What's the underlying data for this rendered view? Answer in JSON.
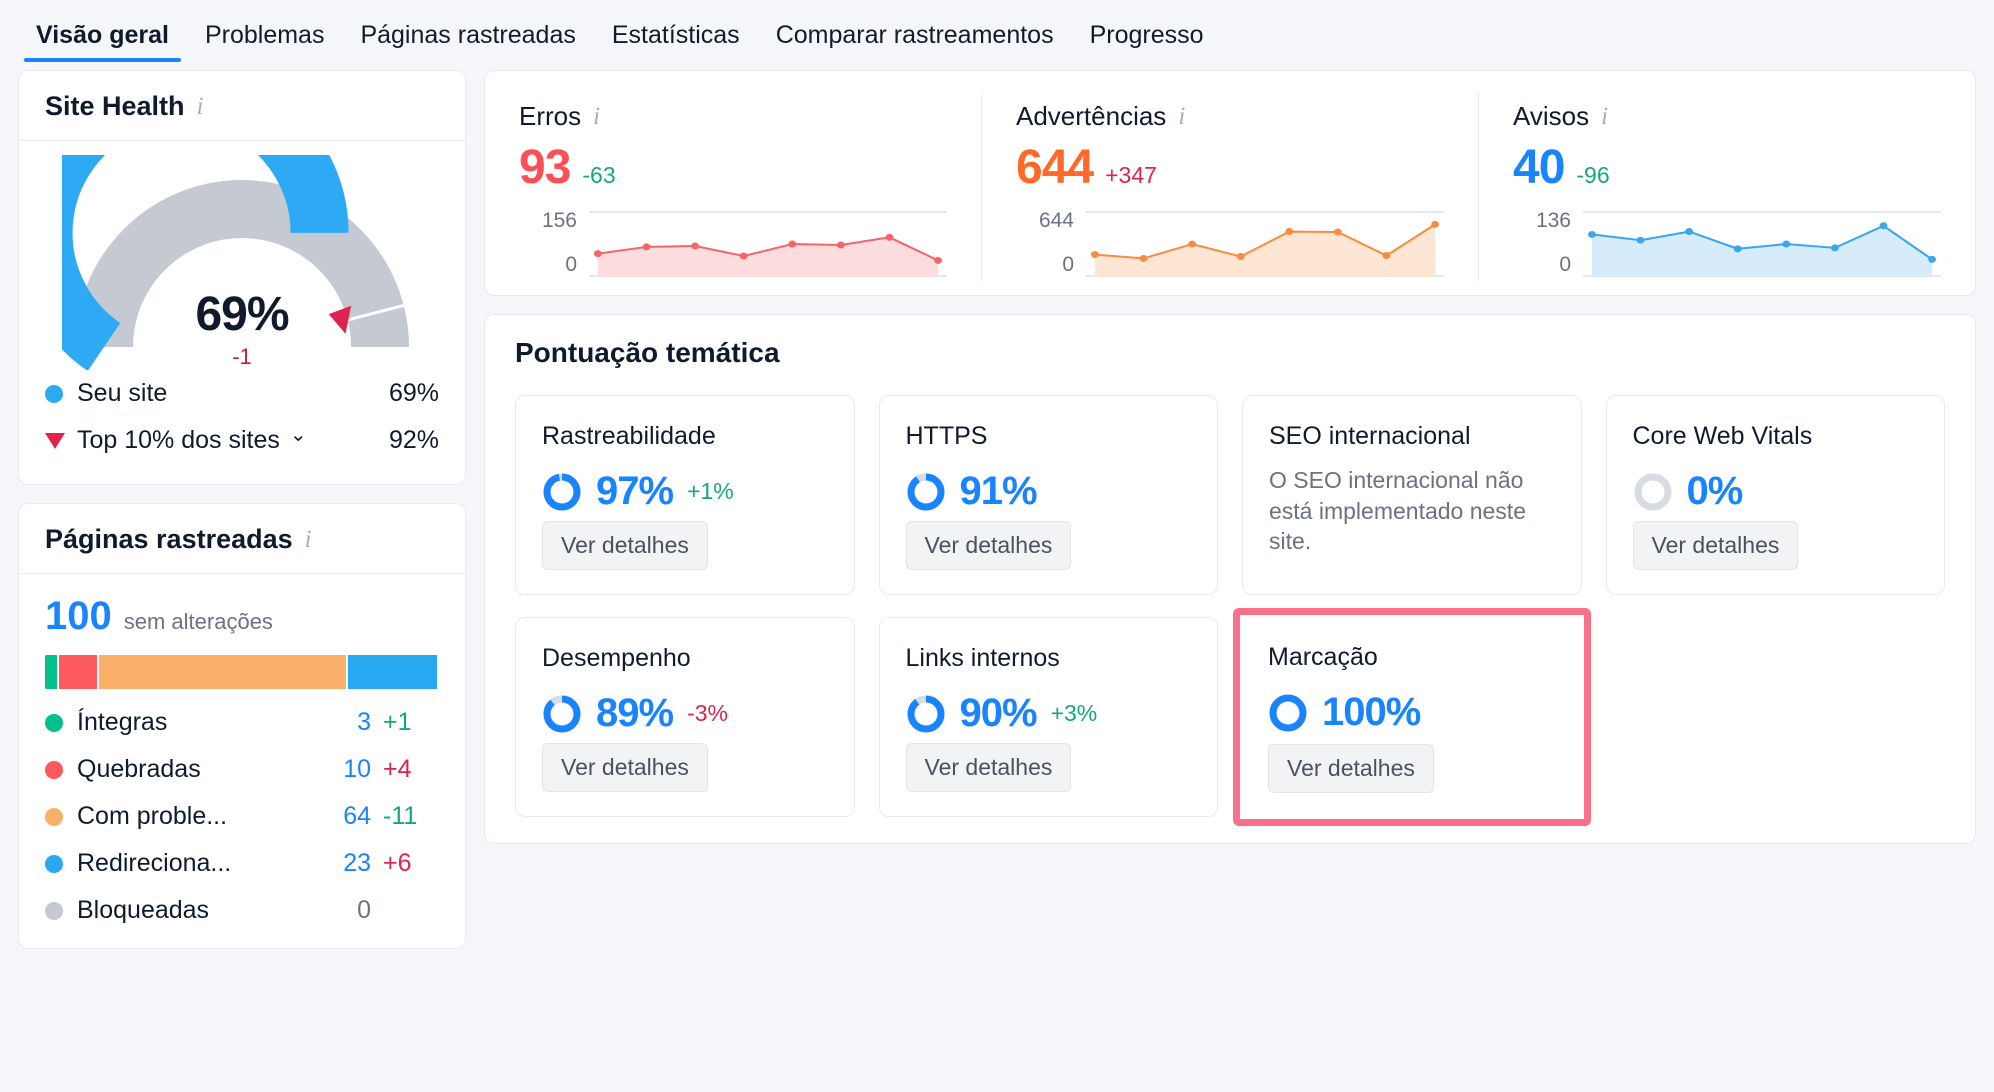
{
  "nav": {
    "tabs": [
      {
        "label": "Visão geral",
        "active": true
      },
      {
        "label": "Problemas",
        "active": false
      },
      {
        "label": "Páginas rastreadas",
        "active": false
      },
      {
        "label": "Estatísticas",
        "active": false
      },
      {
        "label": "Comparar rastreamentos",
        "active": false
      },
      {
        "label": "Progresso",
        "active": false
      }
    ]
  },
  "site_health": {
    "title": "Site Health",
    "info_icon": "info-icon",
    "percent": "69%",
    "delta": "-1",
    "gauge_value": 69,
    "benchmark_value": 92,
    "legend": [
      {
        "marker": "dot",
        "color": "#2eaaf5",
        "label": "Seu site",
        "value": "69%"
      },
      {
        "marker": "triangle",
        "color": "#e0224e",
        "label": "Top 10% dos sites",
        "value": "92%",
        "has_chevron": true
      }
    ]
  },
  "crawled_pages": {
    "title": "Páginas rastreadas",
    "info_icon": "info-icon",
    "total": "100",
    "total_note": "sem alterações",
    "stack": [
      {
        "color": "#00c08b",
        "pct": 3
      },
      {
        "color": "#fc5a5f",
        "pct": 10
      },
      {
        "color": "#fbb069",
        "pct": 64
      },
      {
        "color": "#29a8f2",
        "pct": 23
      }
    ],
    "rows": [
      {
        "color": "#00c08b",
        "label": "Íntegras",
        "value": "3",
        "delta": "+1",
        "delta_dir": "down"
      },
      {
        "color": "#fc5a5f",
        "label": "Quebradas",
        "value": "10",
        "delta": "+4",
        "delta_dir": "up"
      },
      {
        "color": "#fbb069",
        "label": "Com proble...",
        "value": "64",
        "delta": "-11",
        "delta_dir": "down"
      },
      {
        "color": "#29a8f2",
        "label": "Redireciona...",
        "value": "23",
        "delta": "+6",
        "delta_dir": "up"
      },
      {
        "color": "#c4c9d2",
        "label": "Bloqueadas",
        "value": "0",
        "delta": "",
        "delta_dir": "none",
        "value_grey": true
      }
    ]
  },
  "stats": [
    {
      "name": "Erros",
      "info_icon": "info-icon",
      "value": "93",
      "value_color": "#fc4f56",
      "delta": "-63",
      "delta_dir": "down",
      "axis_max": "156",
      "axis_min": "0",
      "line_color": "#f4656b",
      "fill_color": "#fcdcdd",
      "points": [
        0.32,
        0.46,
        0.48,
        0.27,
        0.52,
        0.5,
        0.66,
        0.18
      ]
    },
    {
      "name": "Advertências",
      "info_icon": "info-icon",
      "value": "644",
      "value_color": "#ff6a2b",
      "delta": "+347",
      "delta_dir": "up",
      "axis_max": "644",
      "axis_min": "0",
      "line_color": "#fb8b3e",
      "fill_color": "#fde7d4",
      "points": [
        0.3,
        0.22,
        0.52,
        0.26,
        0.78,
        0.77,
        0.28,
        0.93
      ]
    },
    {
      "name": "Avisos",
      "info_icon": "info-icon",
      "value": "40",
      "value_color": "#1a84ff",
      "delta": "-96",
      "delta_dir": "down",
      "axis_max": "136",
      "axis_min": "0",
      "line_color": "#3aa6f0",
      "fill_color": "#d6ecfb",
      "points": [
        0.72,
        0.6,
        0.78,
        0.42,
        0.52,
        0.44,
        0.9,
        0.2
      ]
    }
  ],
  "thematic": {
    "title": "Pontuação temática",
    "cards": [
      {
        "name": "Rastreabilidade",
        "percent": "97%",
        "value": 97,
        "delta": "+1%",
        "delta_dir": "down",
        "button": "Ver detalhes",
        "note": "",
        "ring_color": "#1a84ff"
      },
      {
        "name": "HTTPS",
        "percent": "91%",
        "value": 91,
        "delta": "",
        "delta_dir": "none",
        "button": "Ver detalhes",
        "note": "",
        "ring_color": "#1a84ff"
      },
      {
        "name": "SEO internacional",
        "percent": "",
        "value": null,
        "delta": "",
        "delta_dir": "none",
        "button": "",
        "note": "O SEO internacional não está implementado neste site.",
        "ring_color": ""
      },
      {
        "name": "Core Web Vitals",
        "percent": "0%",
        "value": 0,
        "delta": "",
        "delta_dir": "none",
        "button": "Ver detalhes",
        "note": "",
        "ring_color": "#1a84ff"
      },
      {
        "name": "Desempenho",
        "percent": "89%",
        "value": 89,
        "delta": "-3%",
        "delta_dir": "up",
        "button": "Ver detalhes",
        "note": "",
        "ring_color": "#1a84ff"
      },
      {
        "name": "Links internos",
        "percent": "90%",
        "value": 90,
        "delta": "+3%",
        "delta_dir": "down",
        "button": "Ver detalhes",
        "note": "",
        "ring_color": "#1a84ff"
      },
      {
        "name": "Marcação",
        "percent": "100%",
        "value": 100,
        "delta": "",
        "delta_dir": "none",
        "button": "Ver detalhes",
        "note": "",
        "ring_color": "#1a84ff",
        "highlighted": true
      }
    ]
  },
  "colors": {
    "accent_blue": "#1a84ff",
    "error_red": "#fc4f56",
    "warning_orange": "#ff6a2b",
    "notice_blue": "#1a84ff",
    "positive_green": "#14a87a",
    "negative_red": "#e0224e",
    "highlight_border": "#f8718b"
  }
}
